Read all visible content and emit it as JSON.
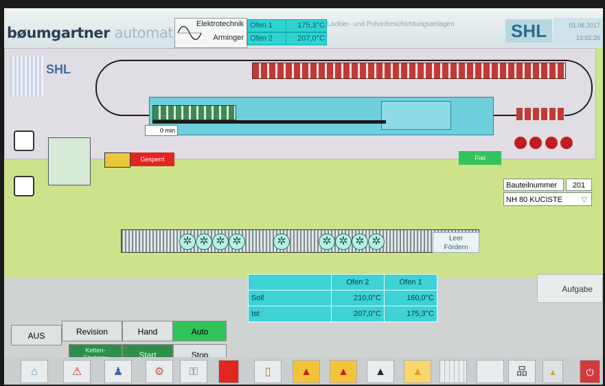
{
  "header": {
    "logo_part1": "bøumgartner",
    "logo_part2": "automation",
    "etech_line1": "Elektrotechnik",
    "etech_line2": "Arminger",
    "oven1_label": "Ofen 1",
    "oven1_value": "175,3°C",
    "oven2_label": "Ofen 2",
    "oven2_value": "207,0°C",
    "company_text": "Lackier- und Pulverbeschichtungsanlagen",
    "shl": "SHL",
    "date": "01.06.2017",
    "time": "13:02:26"
  },
  "plant": {
    "shl_label": "SHL",
    "timer": "0 min",
    "gesperrt_button": "Gesperrt",
    "frei_button": "Frei",
    "leer_foerdern_line1": "Leer",
    "leer_foerdern_line2": "Fördern",
    "bauteil_label": "Bauteilnummer",
    "bauteil_number": "201",
    "bauteil_select": "NH 80 KUCISTE"
  },
  "temps": {
    "col_ofen2": "Ofen 2",
    "col_ofen1": "Ofen 1",
    "row_soll": "Soll",
    "row_ist": "Ist",
    "soll_ofen2": "210,0°C",
    "soll_ofen1": "160,0°C",
    "ist_ofen2": "207,0°C",
    "ist_ofen1": "175,3°C"
  },
  "modes": {
    "aus": "AUS",
    "revision": "Revision",
    "hand": "Hand",
    "auto": "Auto",
    "ketten": "Ketten-\nFörderer",
    "start": "Start",
    "stop": "Stop",
    "aufgabe": "Aufgabe"
  },
  "colors": {
    "accent_cyan": "#3cd2d6",
    "auto_green": "#33c35a",
    "mode_green": "#2f8f4a",
    "alarm_red": "#e0261f",
    "plant_bg": "#cde38a"
  },
  "toolbar_icons": [
    "home-icon",
    "warning-icon",
    "person-icon",
    "gear-flag-icon",
    "key-icon",
    "plc-icon",
    "document-icon",
    "warning-icon",
    "warning-icon",
    "warning-icon",
    "warning-icon",
    "chart-icon",
    "blank-icon",
    "network-icon",
    "warning-small-icon",
    "power-icon"
  ]
}
